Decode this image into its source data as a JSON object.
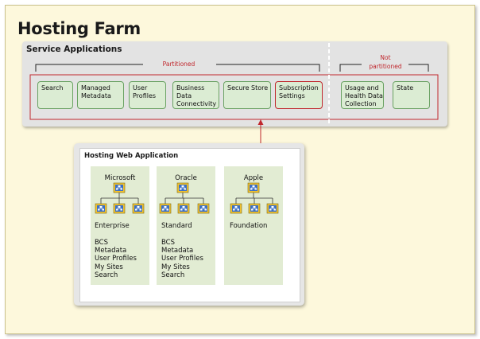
{
  "title": "Hosting Farm",
  "service_applications": {
    "title": "Service Applications",
    "partitioned_label": "Partitioned",
    "not_partitioned_label": [
      "Not",
      "partitioned"
    ],
    "boxes": [
      {
        "lines": [
          "Search"
        ],
        "highlight": false
      },
      {
        "lines": [
          "Managed",
          "Metadata"
        ],
        "highlight": false
      },
      {
        "lines": [
          "User",
          "Profiles"
        ],
        "highlight": false
      },
      {
        "lines": [
          "Business Data",
          "Connectivity"
        ],
        "highlight": false
      },
      {
        "lines": [
          "Secure Store"
        ],
        "highlight": false
      },
      {
        "lines": [
          "Subscription",
          "Settings"
        ],
        "highlight": true
      },
      {
        "lines": [
          "Usage and",
          "Health Data",
          "Collection"
        ],
        "highlight": false
      },
      {
        "lines": [
          "State"
        ],
        "highlight": false
      }
    ]
  },
  "web_application": {
    "title": "Hosting Web Application",
    "columns": [
      {
        "name": "Microsoft",
        "tier": "Enterprise",
        "features": [
          "BCS",
          "Metadata",
          "User Profiles",
          "My Sites",
          "Search"
        ]
      },
      {
        "name": "Oracle",
        "tier": "Standard",
        "features": [
          "BCS",
          "Metadata",
          "User Profiles",
          "My Sites",
          "Search"
        ]
      },
      {
        "name": "Apple",
        "tier": "Foundation",
        "features": []
      }
    ]
  },
  "colors": {
    "frame_bg": "#fdf8dc",
    "panel_bg": "#e3e3e3",
    "box_fill": "#dbecd3",
    "box_border": "#6aa263",
    "accent_red": "#c0272d",
    "column_fill": "#e2ecd3"
  }
}
